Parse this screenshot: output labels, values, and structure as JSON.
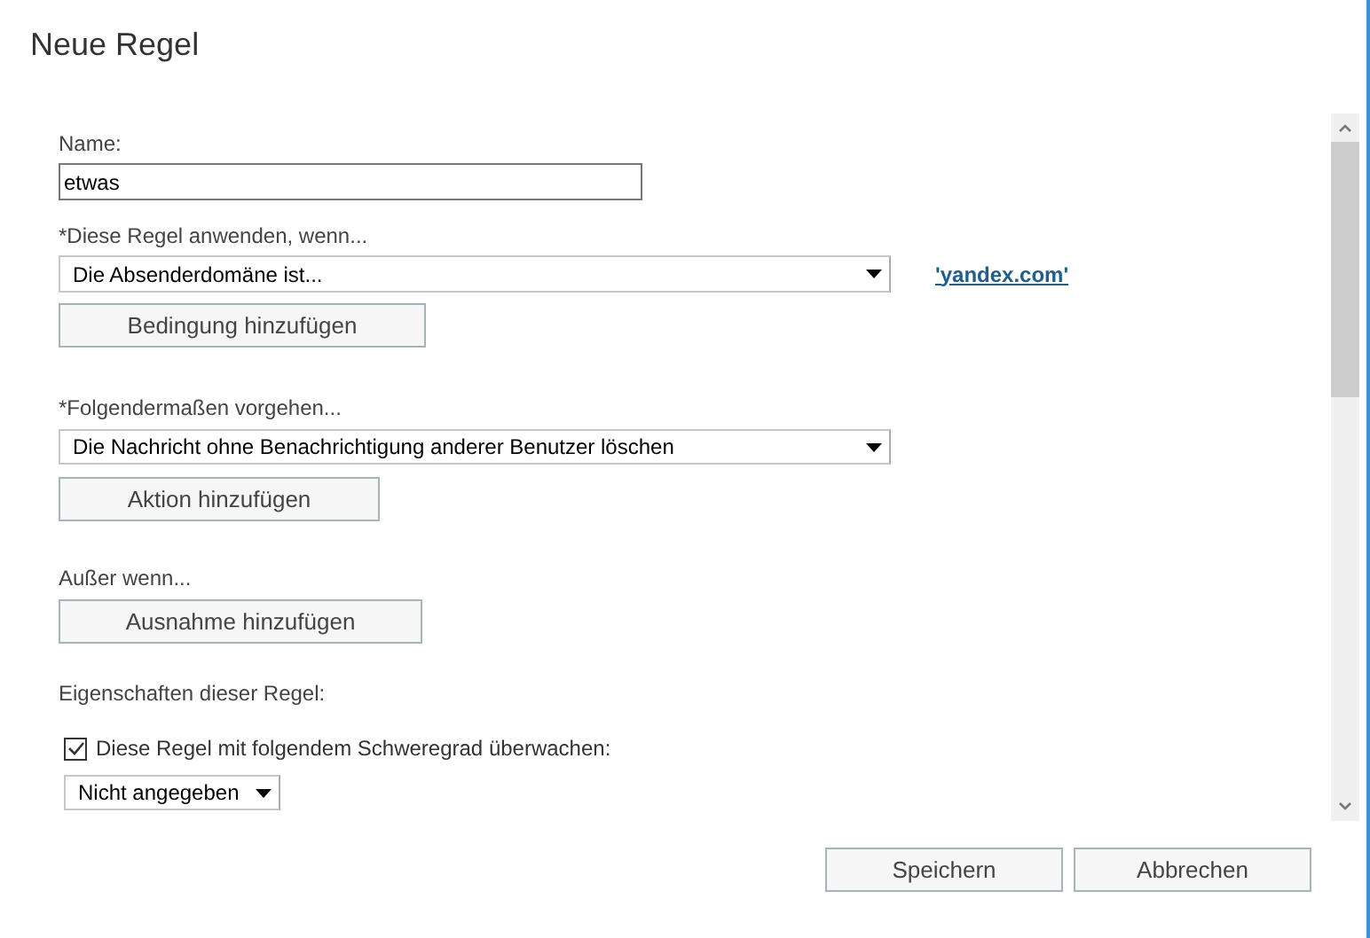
{
  "window": {
    "title": "Neue Regel"
  },
  "name_field": {
    "label": "Name:",
    "value": "etwas"
  },
  "condition": {
    "label": "*Diese Regel anwenden, wenn...",
    "select": "Die Absenderdomäne ist...",
    "link": "'yandex.com'",
    "button": "Bedingung hinzufügen"
  },
  "action": {
    "label": "*Folgendermaßen vorgehen...",
    "select": "Die Nachricht ohne Benachrichtigung anderer Benutzer löschen",
    "button": "Aktion hinzufügen"
  },
  "exception": {
    "label": "Außer wenn...",
    "button": "Ausnahme hinzufügen"
  },
  "properties": {
    "label": "Eigenschaften dieser Regel:",
    "audit": {
      "label": "Diese Regel mit folgendem Schweregrad überwachen:",
      "checked": true
    },
    "severity": "Nicht angegeben"
  },
  "buttons": [
    "Speichern",
    "Abbrechen"
  ]
}
